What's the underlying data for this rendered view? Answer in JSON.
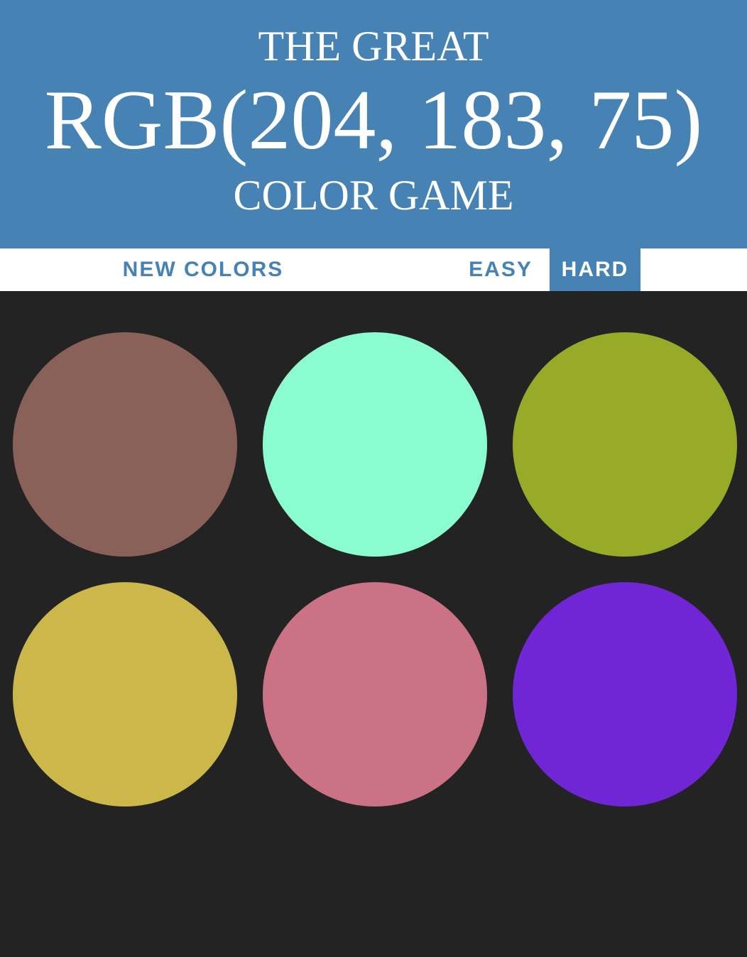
{
  "header": {
    "line1": "THE GREAT",
    "rgb_display": "RGB(204, 183, 75)",
    "line3": "COLOR GAME",
    "background": "#4682b4"
  },
  "controls": {
    "new_colors_label": "NEW COLORS",
    "message": "",
    "modes": [
      {
        "label": "EASY",
        "selected": false
      },
      {
        "label": "HARD",
        "selected": true
      }
    ]
  },
  "board": {
    "background": "#232323",
    "squares": [
      {
        "color": "#8a6159"
      },
      {
        "color": "#8bfcd0"
      },
      {
        "color": "#98ab28"
      },
      {
        "color": "#ccb74b"
      },
      {
        "color": "#cc7287"
      },
      {
        "color": "#7026d5"
      }
    ]
  }
}
